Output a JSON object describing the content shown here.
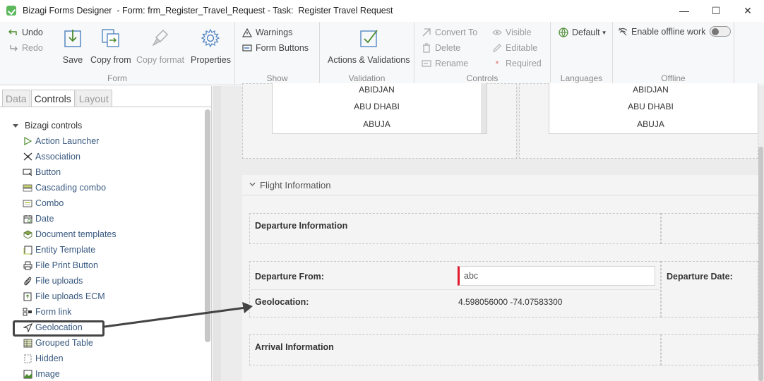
{
  "window": {
    "title": "Bizagi Forms Designer  - Form: frm_Register_Travel_Request - Task:  Register Travel Request",
    "minimize": "—",
    "maximize": "☐",
    "close": "✕"
  },
  "ribbon": {
    "undo": "Undo",
    "redo": "Redo",
    "save": "Save",
    "copy_from": "Copy from",
    "copy_format": "Copy format",
    "properties": "Properties",
    "group_form": "Form",
    "warnings": "Warnings",
    "form_buttons": "Form Buttons",
    "group_show": "Show",
    "actions_validations": "Actions & Validations",
    "group_validation": "Validation",
    "convert_to": "Convert To",
    "delete": "Delete",
    "rename": "Rename",
    "visible": "Visible",
    "editable": "Editable",
    "required": "Required",
    "group_controls": "Controls",
    "language_default": "Default",
    "group_languages": "Languages",
    "enable_offline": "Enable offline work",
    "group_offline": "Offline"
  },
  "left_panel": {
    "tabs": [
      "Data",
      "Controls",
      "Layout"
    ],
    "active_tab": "Controls",
    "tree_root": "Bizagi controls",
    "items": [
      "Action Launcher",
      "Association",
      "Button",
      "Cascading combo",
      "Combo",
      "Date",
      "Document templates",
      "Entity Template",
      "File Print Button",
      "File uploads",
      "File uploads ECM",
      "Form link",
      "Geolocation",
      "Grouped Table",
      "Hidden",
      "Image"
    ]
  },
  "canvas": {
    "list_left": [
      "ABIDJAN",
      "ABU DHABI",
      "ABUJA"
    ],
    "list_right": [
      "ABIDJAN",
      "ABU DHABI",
      "ABUJA"
    ],
    "section_title": "Flight Information",
    "departure_info": "Departure Information",
    "departure_from_label": "Departure From:",
    "departure_from_value": "abc",
    "departure_date_label": "Departure Date:",
    "geolocation_label": "Geolocation:",
    "geolocation_value": "4.598056000 -74.07583300",
    "arrival_info": "Arrival Information"
  },
  "colors": {
    "accent_blue": "#3a6fb0",
    "required_red": "#e0192b",
    "brand_green": "#5cb85c"
  }
}
